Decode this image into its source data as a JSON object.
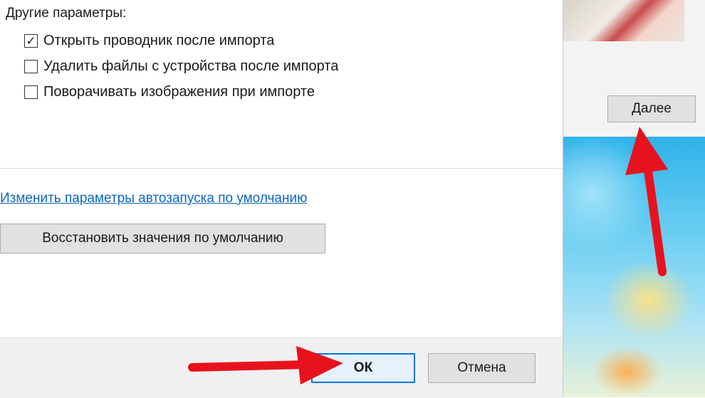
{
  "options": {
    "section_title": "Другие параметры:",
    "checkboxes": [
      {
        "label": "Открыть проводник после импорта",
        "checked": true
      },
      {
        "label": "Удалить файлы с устройства после импорта",
        "checked": false
      },
      {
        "label": "Поворачивать изображения при импорте",
        "checked": false
      }
    ]
  },
  "autoplay_link": "Изменить параметры автозапуска по умолчанию",
  "restore_button": "Восстановить значения по умолчанию",
  "footer": {
    "ok_label": "ОК",
    "cancel_label": "Отмена"
  },
  "background_window": {
    "next_label": "Далее"
  },
  "colors": {
    "annotation_arrow": "#e8121e",
    "link": "#0a66c2",
    "ok_border": "#0078d7"
  },
  "checkmark_glyph": "✓"
}
